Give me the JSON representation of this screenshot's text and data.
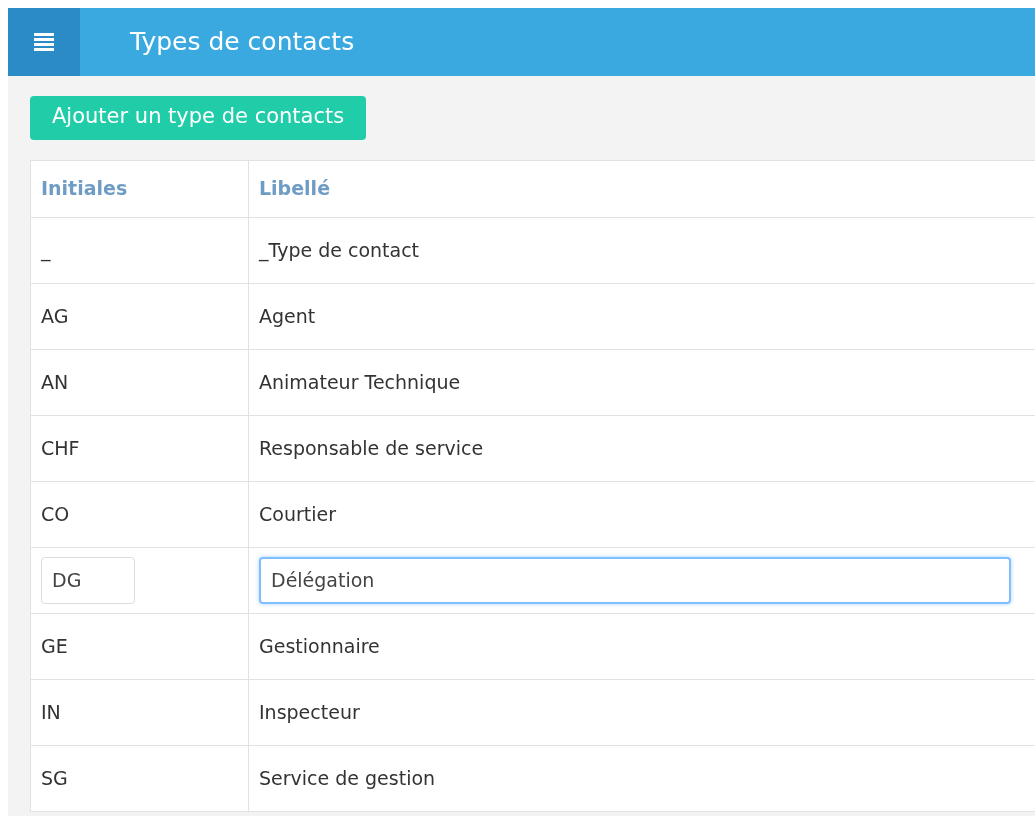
{
  "header": {
    "title": "Types de contacts"
  },
  "add_button": "Ajouter un type de contacts",
  "table": {
    "columns": [
      "Initiales",
      "Libellé"
    ],
    "rows": [
      {
        "initials": "_",
        "label": "_Type de contact",
        "editing": false
      },
      {
        "initials": "AG",
        "label": "Agent",
        "editing": false
      },
      {
        "initials": "AN",
        "label": "Animateur Technique",
        "editing": false
      },
      {
        "initials": "CHF",
        "label": "Responsable de service",
        "editing": false
      },
      {
        "initials": "CO",
        "label": "Courtier",
        "editing": false
      },
      {
        "initials": "DG",
        "label": "Délégation",
        "editing": true,
        "label_focused": true
      },
      {
        "initials": "GE",
        "label": "Gestionnaire",
        "editing": false
      },
      {
        "initials": "IN",
        "label": "Inspecteur",
        "editing": false
      },
      {
        "initials": "SG",
        "label": "Service de gestion",
        "editing": false
      }
    ]
  }
}
